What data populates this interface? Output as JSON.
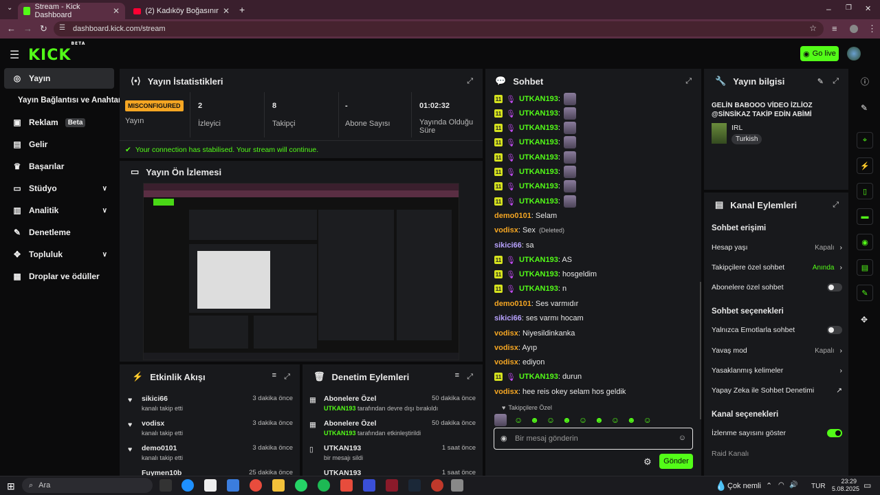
{
  "browser": {
    "tabs": [
      {
        "title": "Stream - Kick Dashboard"
      },
      {
        "title": "(2) Kadıköy Boğasının En Sevdiğ"
      }
    ],
    "url": "dashboard.kick.com/stream"
  },
  "header": {
    "logo": "KICK",
    "logo_badge": "BETA",
    "go_live": "Go live"
  },
  "sidebar": {
    "items": [
      {
        "label": "Yayın"
      },
      {
        "label": "Yayın Bağlantısı ve Anahtarı"
      },
      {
        "label": "Reklam",
        "badge": "Beta"
      },
      {
        "label": "Gelir"
      },
      {
        "label": "Başarılar"
      },
      {
        "label": "Stüdyo"
      },
      {
        "label": "Analitik"
      },
      {
        "label": "Denetleme"
      },
      {
        "label": "Topluluk"
      },
      {
        "label": "Droplar ve ödüller"
      }
    ]
  },
  "stats": {
    "title": "Yayın İstatistikleri",
    "items": [
      {
        "value": "MISCONFIGURED",
        "label": "Yayın"
      },
      {
        "value": "2",
        "label": "İzleyici"
      },
      {
        "value": "8",
        "label": "Takipçi"
      },
      {
        "value": "-",
        "label": "Abone Sayısı"
      },
      {
        "value": "01:02:32",
        "label": "Yayında Olduğu Süre"
      }
    ],
    "notice": "Your connection has stabilised. Your stream will continue."
  },
  "preview": {
    "title": "Yayın Ön İzlemesi"
  },
  "activity": {
    "title": "Etkinlik Akışı",
    "items": [
      {
        "name": "sikici66",
        "action": "kanalı takip etti",
        "ago": "3 dakika önce"
      },
      {
        "name": "vodisx",
        "action": "kanalı takip etti",
        "ago": "3 dakika önce"
      },
      {
        "name": "demo0101",
        "action": "kanalı takip etti",
        "ago": "3 dakika önce"
      },
      {
        "name": "Fuymen10b",
        "action": "",
        "ago": "25 dakika önce"
      }
    ]
  },
  "moderation": {
    "title": "Denetim Eylemleri",
    "items": [
      {
        "title": "Abonelere Özel",
        "user": "UTKAN193",
        "action": "tarafından devre dışı bırakıldı",
        "ago": "50 dakika önce"
      },
      {
        "title": "Abonelere Özel",
        "user": "UTKAN193",
        "action": "tarafından etkinleştirildi",
        "ago": "50 dakika önce"
      },
      {
        "title": "UTKAN193",
        "user": "",
        "action": "bir mesajı sildi",
        "ago": "1 saat önce"
      },
      {
        "title": "UTKAN193",
        "user": "",
        "action": "",
        "ago": "1 saat önce"
      }
    ]
  },
  "chat": {
    "title": "Sohbet",
    "messages": [
      {
        "user": "UTKAN193",
        "text": ":",
        "color": "#53fc18",
        "badge": "11"
      },
      {
        "user": "UTKAN193",
        "text": ":",
        "color": "#53fc18",
        "badge": "11"
      },
      {
        "user": "UTKAN193",
        "text": ":",
        "color": "#53fc18",
        "badge": "11"
      },
      {
        "user": "UTKAN193",
        "text": ":",
        "color": "#53fc18",
        "badge": "11"
      },
      {
        "user": "UTKAN193",
        "text": ":",
        "color": "#53fc18",
        "badge": "11"
      },
      {
        "user": "UTKAN193",
        "text": ":",
        "color": "#53fc18",
        "badge": "11"
      },
      {
        "user": "UTKAN193",
        "text": ":",
        "color": "#53fc18",
        "badge": "11"
      },
      {
        "user": "UTKAN193",
        "text": ":",
        "color": "#53fc18",
        "badge": "11"
      },
      {
        "user": "demo0101",
        "text": ": Selam",
        "color": "#f5a623"
      },
      {
        "user": "vodisx",
        "text": ": Sex",
        "extra": "(Deleted)",
        "color": "#f5a623"
      },
      {
        "user": "sikici66",
        "text": ": sa",
        "color": "#b8a2ff"
      },
      {
        "user": "UTKAN193",
        "text": ": AS",
        "color": "#53fc18",
        "badge": "11"
      },
      {
        "user": "UTKAN193",
        "text": ": hosgeldim",
        "color": "#53fc18",
        "badge": "11"
      },
      {
        "user": "UTKAN193",
        "text": ": n",
        "color": "#53fc18",
        "badge": "11"
      },
      {
        "user": "demo0101",
        "text": ": Ses varmıdır",
        "color": "#f5a623"
      },
      {
        "user": "sikici66",
        "text": ": ses varmı hocam",
        "color": "#b8a2ff"
      },
      {
        "user": "vodisx",
        "text": ": Niyesildinkanka",
        "color": "#f5a623"
      },
      {
        "user": "vodisx",
        "text": ": Ayıp",
        "color": "#f5a623"
      },
      {
        "user": "vodisx",
        "text": ": ediyon",
        "color": "#f5a623"
      },
      {
        "user": "UTKAN193",
        "text": ": durun",
        "color": "#53fc18",
        "badge": "11"
      },
      {
        "user": "vodisx",
        "text": ": hee reis okey selam hos geldik",
        "color": "#f5a623"
      }
    ],
    "followers_only": "Takipçilere Özel",
    "input_placeholder": "Bir mesaj gönderin",
    "send": "Gönder"
  },
  "stream_info": {
    "title": "Yayın bilgisi",
    "stream_title": "GELİN BABOOO VİDEO İZLİOZ @SİNSİKAZ TAKİP EDİN ABİMİ",
    "category": "IRL",
    "language": "Turkish"
  },
  "channel_actions": {
    "title": "Kanal Eylemleri",
    "chat_access": "Sohbet erişimi",
    "rows1": [
      {
        "label": "Hesap yaşı",
        "value": "Kapalı"
      },
      {
        "label": "Takipçilere özel sohbet",
        "value": "Anında"
      },
      {
        "label": "Abonelere özel sohbet",
        "value": ""
      }
    ],
    "chat_options": "Sohbet seçenekleri",
    "rows2": [
      {
        "label": "Yalnızca Emotlarla sohbet",
        "value": ""
      },
      {
        "label": "Yavaş mod",
        "value": "Kapalı"
      },
      {
        "label": "Yasaklanmış kelimeler",
        "value": ""
      },
      {
        "label": "Yapay Zeka ile Sohbet Denetimi",
        "value": ""
      }
    ],
    "channel_options": "Kanal seçenekleri",
    "rows3": [
      {
        "label": "İzlenme sayısını göster",
        "value": ""
      },
      {
        "label": "Raid Kanalı",
        "value": ""
      }
    ]
  },
  "taskbar": {
    "search": "Ara",
    "weather": "Çok nemli",
    "lang": "TUR",
    "time": "23:29",
    "date": "5.08.2025"
  }
}
